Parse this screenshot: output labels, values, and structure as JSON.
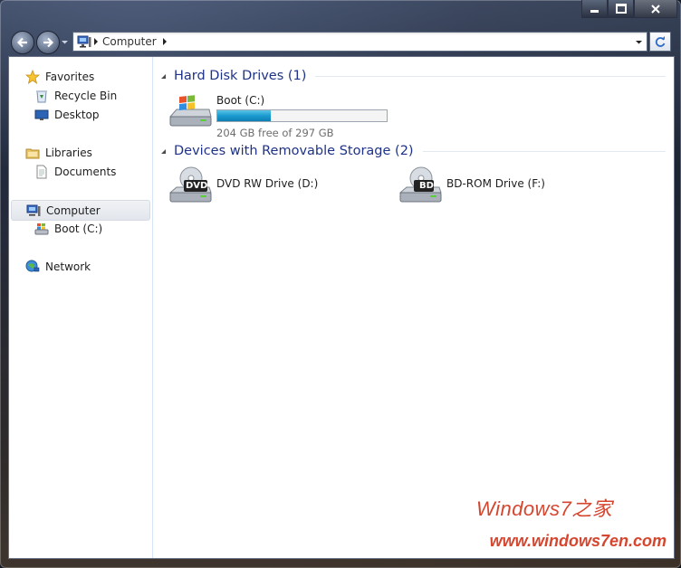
{
  "address": {
    "path": [
      "Computer"
    ]
  },
  "nav_pane": {
    "favorites": {
      "label": "Favorites",
      "items": [
        {
          "label": "Recycle Bin"
        },
        {
          "label": "Desktop"
        }
      ]
    },
    "libraries": {
      "label": "Libraries",
      "items": [
        {
          "label": "Documents"
        }
      ]
    },
    "computer": {
      "label": "Computer",
      "items": [
        {
          "label": "Boot (C:)"
        }
      ]
    },
    "network": {
      "label": "Network"
    }
  },
  "groups": {
    "hard_disk": {
      "title": "Hard Disk Drives (1)",
      "drives": [
        {
          "name": "Boot (C:)",
          "free_text": "204 GB free of 297 GB",
          "used_fraction": 0.313,
          "icon": "windows-drive-icon"
        }
      ]
    },
    "removable": {
      "title": "Devices with Removable Storage (2)",
      "drives": [
        {
          "name": "DVD RW Drive (D:)",
          "badge": "DVD",
          "icon": "dvd-drive-icon"
        },
        {
          "name": "BD-ROM Drive (F:)",
          "badge": "BD",
          "icon": "bd-drive-icon"
        }
      ]
    }
  },
  "watermark": {
    "line1": "Windows7之家",
    "line2": "www.windows7en.com"
  },
  "colors": {
    "group_title": "#1e3287",
    "bar_fill": "#1a9bd0",
    "watermark": "#d6452e"
  }
}
